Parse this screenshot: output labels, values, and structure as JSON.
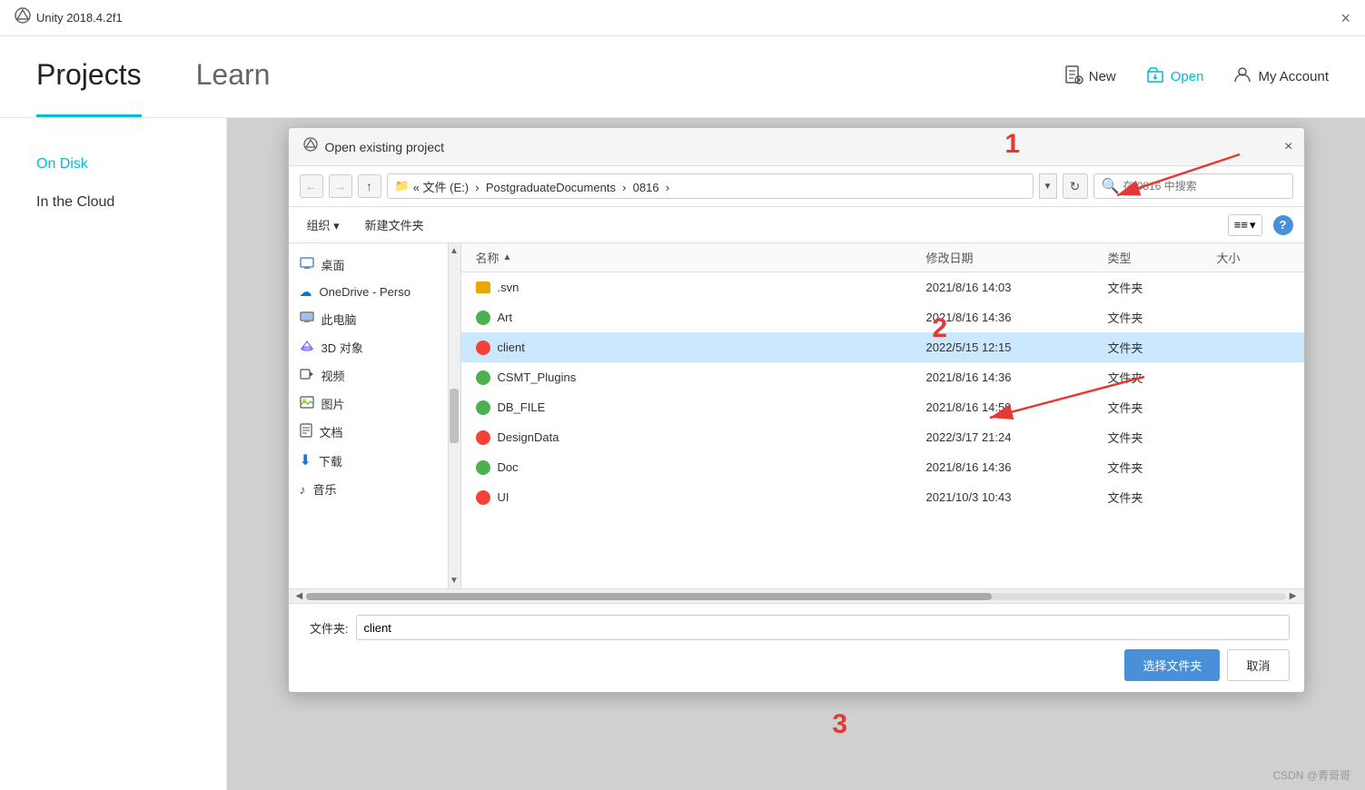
{
  "titleBar": {
    "text": "Unity 2018.4.2f1",
    "closeBtn": "×"
  },
  "header": {
    "tabs": [
      {
        "id": "projects",
        "label": "Projects",
        "active": true
      },
      {
        "id": "learn",
        "label": "Learn",
        "active": false
      }
    ],
    "actions": [
      {
        "id": "new",
        "label": "New",
        "icon": "📄"
      },
      {
        "id": "open",
        "label": "Open",
        "icon": "📂"
      },
      {
        "id": "myaccount",
        "label": "My Account",
        "icon": "👤"
      }
    ]
  },
  "sidebar": {
    "items": [
      {
        "id": "ondisk",
        "label": "On Disk",
        "active": true
      },
      {
        "id": "inthecloud",
        "label": "In the Cloud",
        "active": false
      }
    ]
  },
  "dialog": {
    "title": "Open existing project",
    "closeBtn": "×",
    "breadcrumb": {
      "path": "« 文件 (E:)  ›  PostgraduateDocuments  ›  0816  ›",
      "searchPlaceholder": "在 0816 中搜索"
    },
    "toolbar": {
      "organize": "组织 ▾",
      "newFolder": "新建文件夹",
      "viewBtn": "≡≡ ▾",
      "helpBtn": "?"
    },
    "columns": {
      "name": "名称",
      "modified": "修改日期",
      "type": "类型",
      "size": "大小"
    },
    "leftPanel": [
      {
        "id": "desktop",
        "label": "桌面",
        "icon": "folder-blue"
      },
      {
        "id": "onedrive",
        "label": "OneDrive - Perso",
        "icon": "onedrive"
      },
      {
        "id": "thispc",
        "label": "此电脑",
        "icon": "pc"
      },
      {
        "id": "3dobjects",
        "label": "3D 对象",
        "icon": "3d"
      },
      {
        "id": "video",
        "label": "视频",
        "icon": "video"
      },
      {
        "id": "pictures",
        "label": "图片",
        "icon": "pictures"
      },
      {
        "id": "documents",
        "label": "文档",
        "icon": "documents"
      },
      {
        "id": "downloads",
        "label": "下载",
        "icon": "downloads"
      },
      {
        "id": "music",
        "label": "音乐",
        "icon": "music"
      }
    ],
    "files": [
      {
        "id": "svn",
        "name": ".svn",
        "modified": "2021/8/16 14:03",
        "type": "文件夹",
        "size": "",
        "icon": "folder-yellow",
        "selected": false
      },
      {
        "id": "art",
        "name": "Art",
        "modified": "2021/8/16 14:36",
        "type": "文件夹",
        "size": "",
        "icon": "unity-green",
        "selected": false
      },
      {
        "id": "client",
        "name": "client",
        "modified": "2022/5/15 12:15",
        "type": "文件夹",
        "size": "",
        "icon": "unity-red",
        "selected": true
      },
      {
        "id": "csmt",
        "name": "CSMT_Plugins",
        "modified": "2021/8/16 14:36",
        "type": "文件夹",
        "size": "",
        "icon": "unity-green",
        "selected": false
      },
      {
        "id": "dbfile",
        "name": "DB_FILE",
        "modified": "2021/8/16 14:50",
        "type": "文件夹",
        "size": "",
        "icon": "unity-green",
        "selected": false
      },
      {
        "id": "designdata",
        "name": "DesignData",
        "modified": "2022/3/17 21:24",
        "type": "文件夹",
        "size": "",
        "icon": "unity-red",
        "selected": false
      },
      {
        "id": "doc",
        "name": "Doc",
        "modified": "2021/8/16 14:36",
        "type": "文件夹",
        "size": "",
        "icon": "unity-green",
        "selected": false
      },
      {
        "id": "ui",
        "name": "UI",
        "modified": "2021/10/3 10:43",
        "type": "文件夹",
        "size": "",
        "icon": "unity-red",
        "selected": false
      }
    ],
    "fileNameLabel": "文件夹:",
    "fileNameValue": "client",
    "buttons": {
      "confirm": "选择文件夹",
      "cancel": "取消"
    }
  },
  "annotations": {
    "number1": "1",
    "number2": "2",
    "number3": "3"
  },
  "watermark": "CSDN @青哥哥"
}
